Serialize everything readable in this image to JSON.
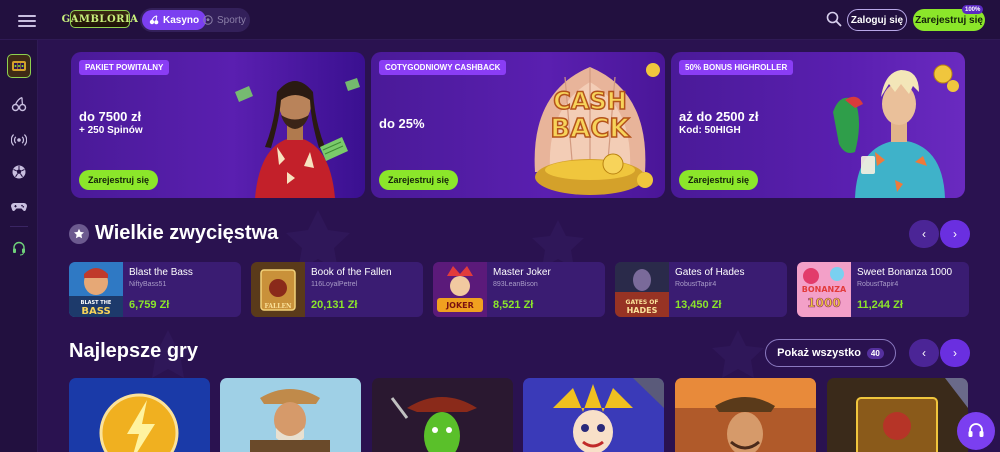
{
  "header": {
    "logo_text": "GAMBLORIA",
    "modes": [
      {
        "label": "Kasyno",
        "active": true
      },
      {
        "label": "Sporty",
        "active": false
      }
    ],
    "login_label": "Zaloguj się",
    "register_label": "Zarejestruj się",
    "register_badge": "100%"
  },
  "sidebar": {
    "items": [
      {
        "icon": "slot-machine-icon",
        "active": true
      },
      {
        "icon": "cherries-icon"
      },
      {
        "icon": "live-broadcast-icon"
      },
      {
        "icon": "soccer-ball-icon"
      },
      {
        "icon": "gamepad-icon"
      },
      {
        "icon": "headset-icon"
      }
    ]
  },
  "promos": [
    {
      "tag": "PAKIET POWITALNY",
      "headline": "do 7500 zł",
      "subline": "+ 250 Spinów",
      "cta": "Zarejestruj się"
    },
    {
      "tag": "COTYGODNIOWY CASHBACK",
      "headline": "do 25%",
      "subline": "",
      "art_text_1": "CASH",
      "art_text_2": "BACK",
      "cta": "Zarejestruj się"
    },
    {
      "tag": "50% BONUS HIGHROLLER",
      "headline": "aż do 2500 zł",
      "subline": "Kod: 50HIGH",
      "cta": "Zarejestruj się"
    }
  ],
  "big_wins": {
    "title": "Wielkie zwycięstwa",
    "items": [
      {
        "game": "Blast the Bass",
        "user": "NiftyBass51",
        "amount": "6,759 Zł",
        "thumb_text": "BLAST THE BASS"
      },
      {
        "game": "Book of the Fallen",
        "user": "116LoyalPetrel",
        "amount": "20,131 Zł",
        "thumb_text": "BOOK OF FALLEN"
      },
      {
        "game": "Master Joker",
        "user": "893LeanBison",
        "amount": "8,521 Zł",
        "thumb_text": "MASTER JOKER"
      },
      {
        "game": "Gates of Hades",
        "user": "RobustTapir4",
        "amount": "13,450 Zł",
        "thumb_text": "GATES OF HADES"
      },
      {
        "game": "Sweet Bonanza 1000",
        "user": "RobustTapir4",
        "amount": "11,244 Zł",
        "thumb_text": "SWEET BONANZA 1000"
      }
    ]
  },
  "best_games": {
    "title": "Najlepsze gry",
    "show_all_label": "Pokaż wszystko",
    "count": "40"
  },
  "colors": {
    "background": "#2a1250",
    "accent_green": "#8be62a",
    "accent_purple": "#7b3ff0"
  }
}
